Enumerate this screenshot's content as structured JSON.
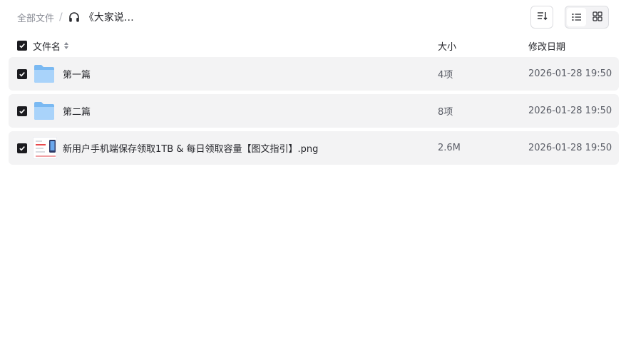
{
  "breadcrumb": {
    "root": "全部文件",
    "separator": "/",
    "current": "《大家说…",
    "current_icon": "headphones-icon"
  },
  "toolbar": {
    "sort_icon": "sort-icon",
    "view_list_icon": "list-view-icon",
    "view_grid_icon": "grid-view-icon",
    "active_view": "list"
  },
  "table": {
    "headers": {
      "name": "文件名",
      "size": "大小",
      "modified": "修改日期"
    },
    "select_all_checked": true,
    "rows": [
      {
        "type": "folder",
        "name": "第一篇",
        "size": "4项",
        "modified": "2026-01-28 19:50",
        "checked": true
      },
      {
        "type": "folder",
        "name": "第二篇",
        "size": "8项",
        "modified": "2026-01-28 19:50",
        "checked": true
      },
      {
        "type": "image",
        "name": "新用户手机端保存领取1TB & 每日领取容量【图文指引】.png",
        "size": "2.6M",
        "modified": "2026-01-28 19:50",
        "checked": true
      }
    ]
  },
  "colors": {
    "folder": "#6fb2f0",
    "checkbox": "#1b1b1f",
    "row_bg": "#f3f3f4"
  }
}
